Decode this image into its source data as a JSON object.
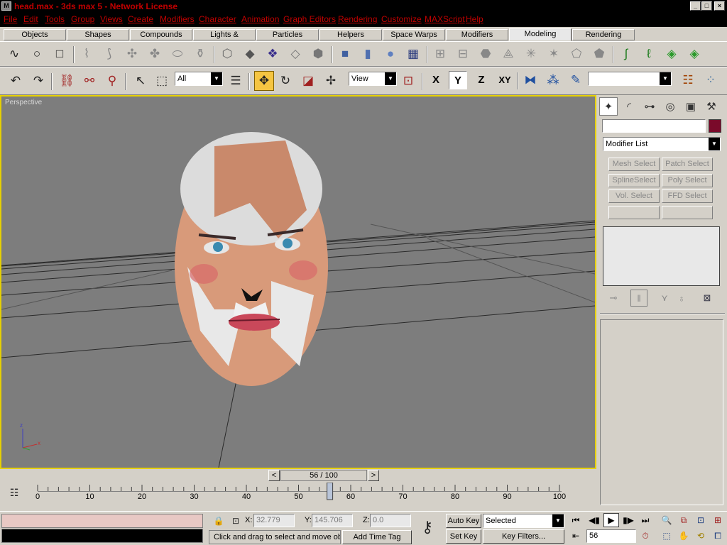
{
  "window": {
    "title": "head.max - 3ds max 5 - Network License",
    "min_label": "_",
    "max_label": "□",
    "close_label": "×"
  },
  "menu": [
    "File",
    "Edit",
    "Tools",
    "Group",
    "Views",
    "Create",
    "Modifiers",
    "Character",
    "Animation",
    "Graph Editors",
    "Rendering",
    "Customize",
    "MAXScript",
    "Help"
  ],
  "tabs": [
    "Objects",
    "Shapes",
    "Compounds",
    "Lights & Cameras",
    "Particles",
    "Helpers",
    "Space Warps",
    "Modifiers",
    "Modeling",
    "Rendering"
  ],
  "active_tab": "Modeling",
  "main_toolbar": {
    "selection_filter": "All",
    "reference_coord": "View",
    "axis_x": "X",
    "axis_y": "Y",
    "axis_z": "Z",
    "axis_xy": "XY",
    "named_selection": ""
  },
  "viewport": {
    "label": "Perspective",
    "accent": "#e6d000"
  },
  "command_panel": {
    "object_name": "",
    "object_color": "#7a0a2a",
    "modifier_list": "Modifier List",
    "buttons": [
      "Mesh Select",
      "Patch Select",
      "SplineSelect",
      "Poly Select",
      "Vol. Select",
      "FFD Select",
      "",
      ""
    ]
  },
  "time_slider": {
    "frame_label": "56 / 100",
    "prev": "<",
    "next": ">"
  },
  "track": {
    "ticks": [
      "0",
      "10",
      "20",
      "30",
      "40",
      "50",
      "60",
      "70",
      "80",
      "90",
      "100"
    ],
    "current": 56,
    "max": 100
  },
  "status": {
    "coord_x_label": "X:",
    "coord_x": "32.779",
    "coord_y_label": "Y:",
    "coord_y": "145.706",
    "coord_z_label": "Z:",
    "coord_z": "0.0",
    "prompt": "Click and drag to select and move obj",
    "add_time_tag": "Add Time Tag",
    "auto_key": "Auto Key",
    "set_key": "Set Key",
    "key_mode": "Selected",
    "key_filters": "Key Filters...",
    "frame_field": "56"
  }
}
